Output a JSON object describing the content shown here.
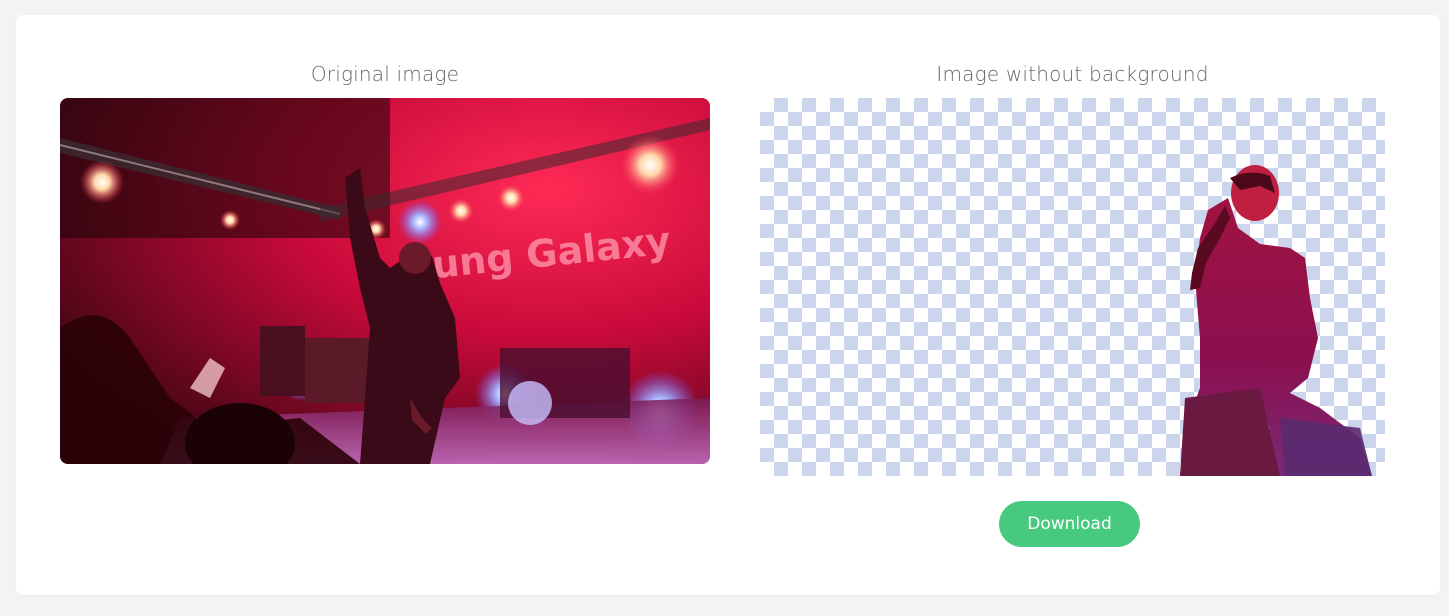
{
  "left_panel": {
    "heading": "Original image",
    "image_text": "ung Galaxy"
  },
  "right_panel": {
    "heading": "Image without background"
  },
  "download_button": {
    "label": "Download"
  },
  "colors": {
    "accent": "#48c980",
    "checker": "#cbd5eb",
    "stage_red": "#e8103a"
  }
}
